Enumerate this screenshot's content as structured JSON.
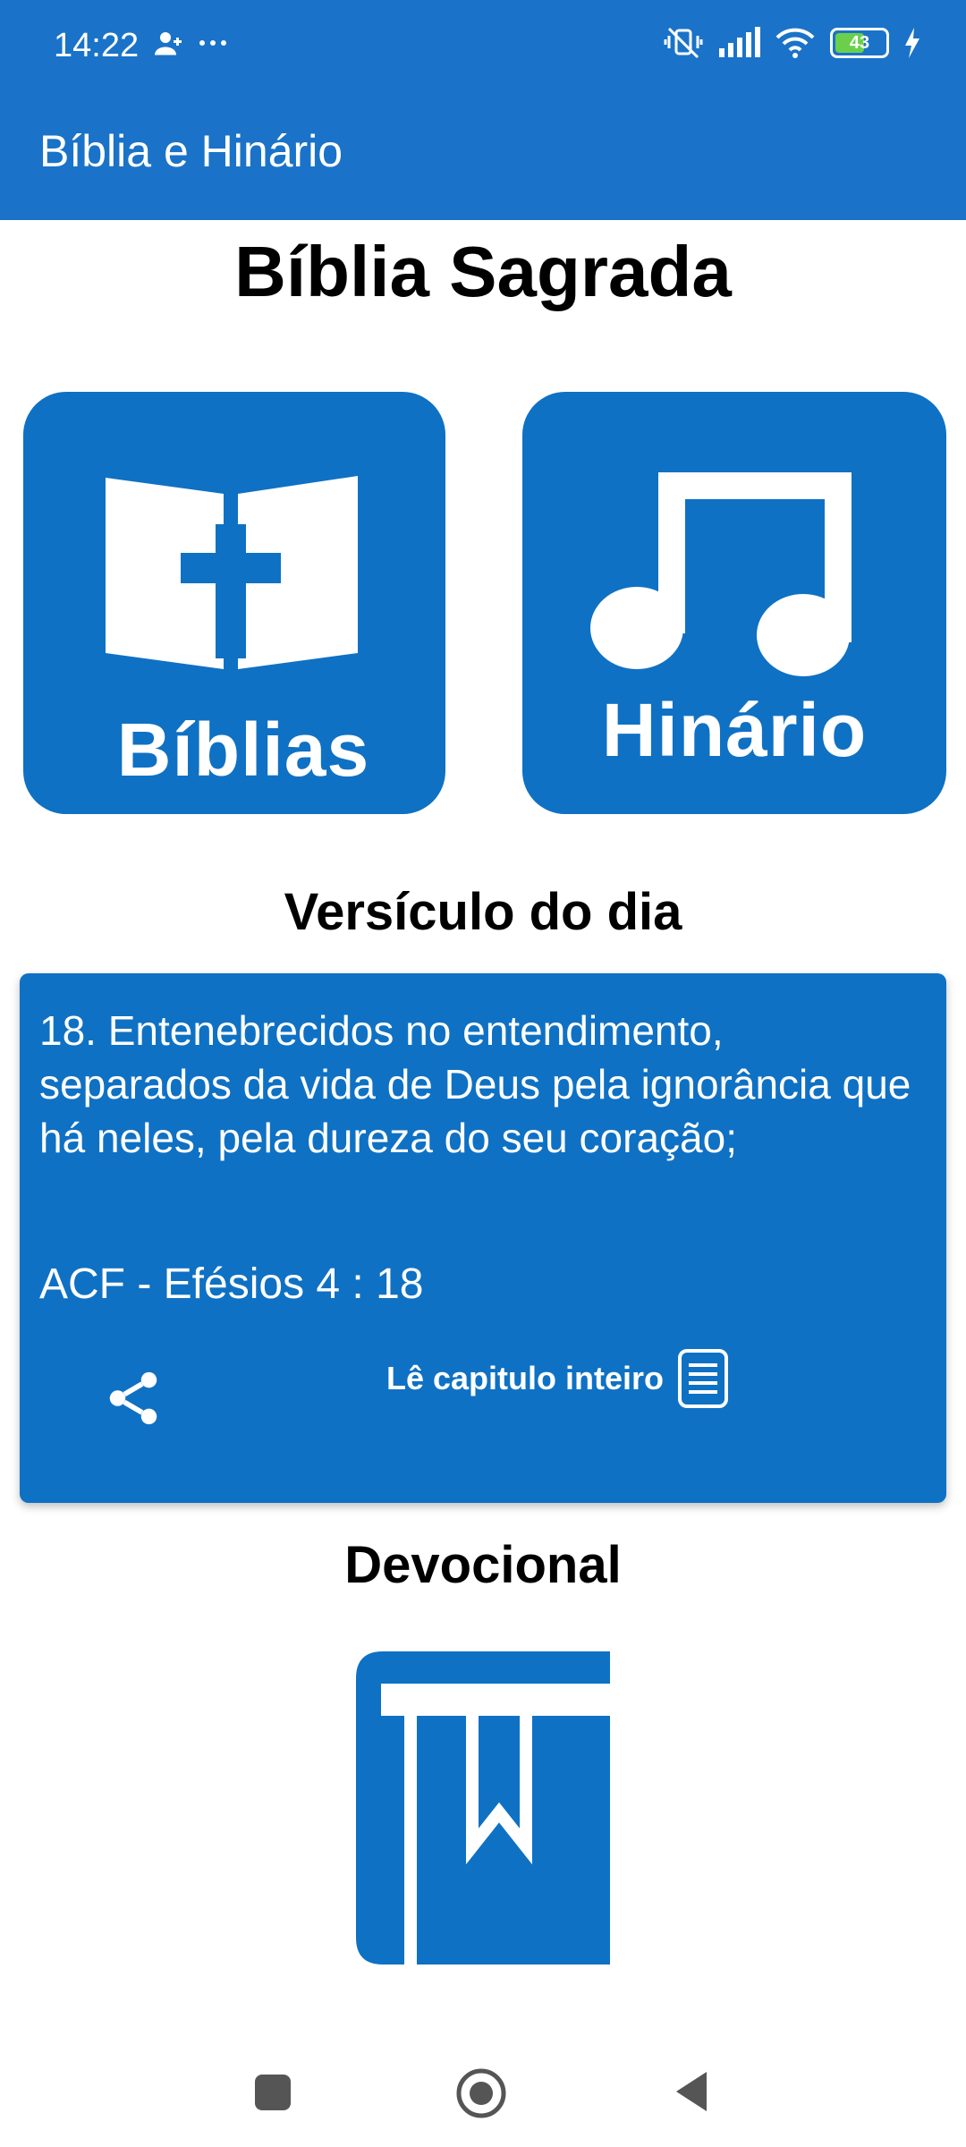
{
  "status_bar": {
    "time": "14:22",
    "battery": "43",
    "icons": [
      "person-add-icon",
      "more-dots-icon",
      "vibrate-off-icon",
      "signal-icon",
      "wifi-icon",
      "battery-icon",
      "charging-icon"
    ]
  },
  "app_bar": {
    "title": "Bíblia e Hinário"
  },
  "main": {
    "page_title": "Bíblia Sagrada",
    "tiles": [
      {
        "label": "Bíblias",
        "icon": "open-bible-cross-icon"
      },
      {
        "label": "Hinário",
        "icon": "music-note-icon"
      }
    ],
    "verse_section_title": "Versículo do dia",
    "verse": {
      "text": "18. Entenebrecidos no entendimento, separados da vida de Deus pela ignorância que há neles, pela dureza do seu coração;",
      "reference": "ACF - Efésios  4 : 18",
      "read_chapter_label": "Lê capitulo inteiro"
    },
    "devotional_title": "Devocional"
  },
  "colors": {
    "primary": "#1a73c8",
    "tile": "#0f71c4",
    "background": "#ffffff"
  },
  "nav_bar": {
    "buttons": [
      "recents-square-icon",
      "home-circle-icon",
      "back-triangle-icon"
    ]
  }
}
